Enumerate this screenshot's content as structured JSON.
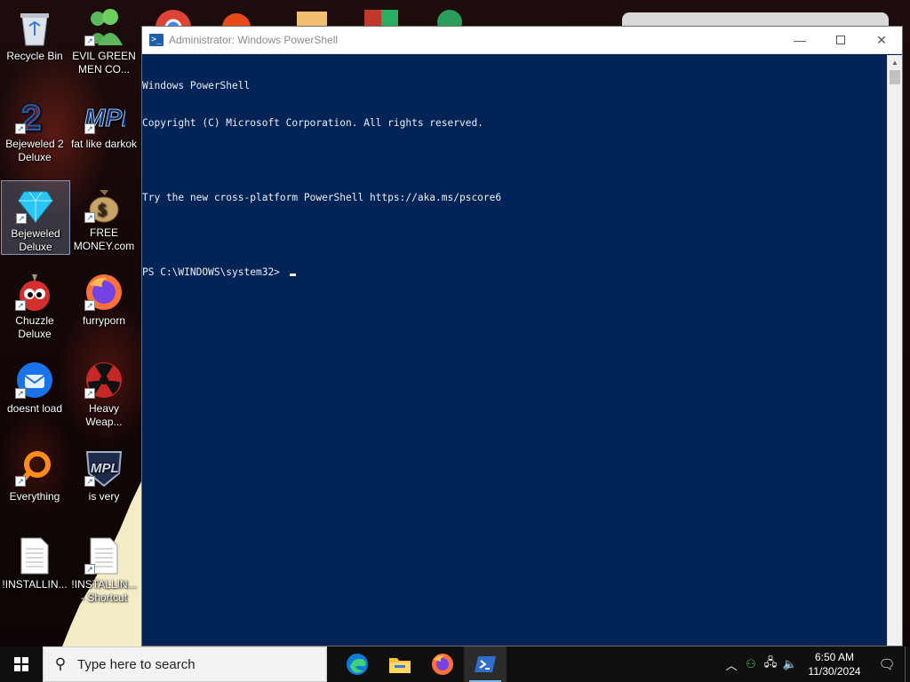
{
  "desktop": {
    "icons": [
      {
        "label": "Recycle Bin",
        "icon": "recycle-bin-icon"
      },
      {
        "label": "EVIL GREEN MEN CO...",
        "icon": "green-people-icon"
      },
      {
        "label": "Bejeweled 2 Deluxe",
        "icon": "bejeweled2-icon"
      },
      {
        "label": "fat like darkok",
        "icon": "mpl-logo-icon"
      },
      {
        "label": "Bejeweled Deluxe",
        "icon": "diamond-icon"
      },
      {
        "label": "FREE MONEY.com",
        "icon": "money-bag-icon"
      },
      {
        "label": "Chuzzle Deluxe",
        "icon": "chuzzle-icon"
      },
      {
        "label": "furryporn",
        "icon": "firefox-icon"
      },
      {
        "label": "doesnt load",
        "icon": "thunderbird-icon"
      },
      {
        "label": "Heavy Weap...",
        "icon": "radiation-icon"
      },
      {
        "label": "Everything",
        "icon": "everything-search-icon"
      },
      {
        "label": "is very",
        "icon": "mpl-shield-icon"
      },
      {
        "label": "!INSTALLIN...",
        "icon": "text-document-icon"
      },
      {
        "label": "!INSTALLIN... - Shortcut",
        "icon": "text-document-icon"
      }
    ]
  },
  "window": {
    "title": "Administrator: Windows PowerShell",
    "console_lines": [
      "Windows PowerShell",
      "Copyright (C) Microsoft Corporation. All rights reserved.",
      "",
      "Try the new cross-platform PowerShell https://aka.ms/pscore6",
      "",
      "PS C:\\WINDOWS\\system32> "
    ],
    "colors": {
      "background": "#012456",
      "text": "#eeedf0"
    }
  },
  "taskbar": {
    "search_placeholder": "Type here to search",
    "pinned_apps": [
      {
        "icon": "edge-icon"
      },
      {
        "icon": "file-explorer-icon"
      },
      {
        "icon": "firefox-icon"
      },
      {
        "icon": "powershell-icon"
      }
    ],
    "clock": {
      "time": "6:50 AM",
      "date": "11/30/2024"
    }
  }
}
